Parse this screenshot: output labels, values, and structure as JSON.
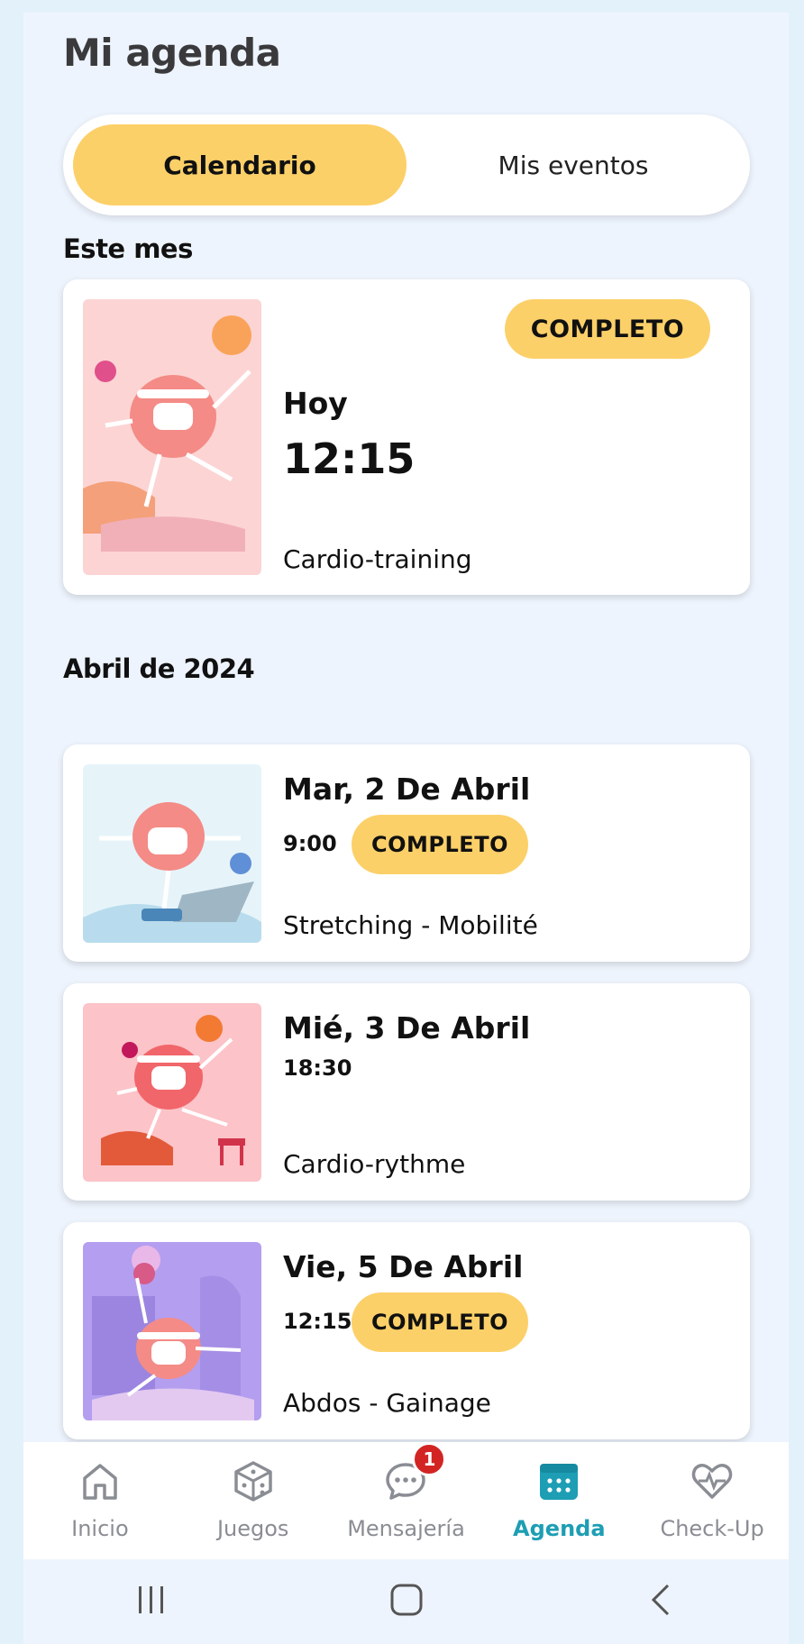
{
  "header": {
    "title": "Mi agenda"
  },
  "tabs": {
    "calendar_label": "Calendario",
    "events_label": "Mis eventos",
    "selected": "Calendario"
  },
  "sections": [
    {
      "title": "Este mes",
      "events": [
        {
          "date": "Hoy",
          "time": "12:15",
          "status": "COMPLETO",
          "name": "Cardio-training",
          "thumb_theme": "pink"
        }
      ]
    },
    {
      "title": "Abril de 2024",
      "events": [
        {
          "date": "Mar, 2 De Abril",
          "time": "9:00",
          "status": "COMPLETO",
          "name": "Stretching - Mobilité",
          "thumb_theme": "blue"
        },
        {
          "date": "Mié, 3 De Abril",
          "time": "18:30",
          "status": "",
          "name": "Cardio-rythme",
          "thumb_theme": "pink"
        },
        {
          "date": "Vie, 5 De Abril",
          "time": "12:15",
          "status": "COMPLETO",
          "name": "Abdos - Gainage",
          "thumb_theme": "purple"
        }
      ]
    }
  ],
  "bottom_nav": {
    "items": [
      {
        "label": "Inicio",
        "icon": "home-icon"
      },
      {
        "label": "Juegos",
        "icon": "dice-icon"
      },
      {
        "label": "Mensajería",
        "icon": "chat-icon",
        "badge": "1"
      },
      {
        "label": "Agenda",
        "icon": "calendar-icon",
        "active": true
      },
      {
        "label": "Check-Up",
        "icon": "heart-pulse-icon"
      }
    ]
  },
  "colors": {
    "accent_yellow": "#fcd068",
    "active_teal": "#1d9eb4",
    "notification_red": "#d32424",
    "background": "#eef4fd"
  }
}
